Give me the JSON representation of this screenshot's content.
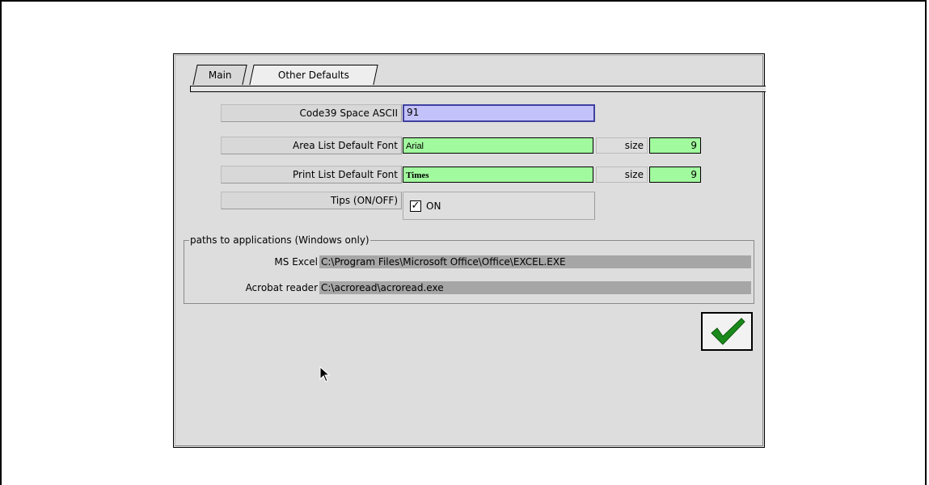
{
  "tabs": [
    {
      "label": "Main"
    },
    {
      "label": "Other Defaults"
    }
  ],
  "fields": {
    "code39": {
      "label": "Code39 Space ASCII",
      "value": "91"
    },
    "area_font": {
      "label": "Area List Default Font",
      "value": "Arial",
      "size_label": "size",
      "size": "9"
    },
    "print_font": {
      "label": "Print List Default Font",
      "value": "Times",
      "size_label": "size",
      "size": "9"
    },
    "tips": {
      "label": "Tips (ON/OFF)",
      "checkbox_label": "ON",
      "checked": true
    }
  },
  "paths": {
    "legend": "paths to applications (Windows only)",
    "excel": {
      "label": "MS Excel",
      "value": "C:\\Program Files\\Microsoft Office\\Office\\EXCEL.EXE"
    },
    "acrobat": {
      "label": "Acrobat reader",
      "value": "C:\\acroread\\acroread.exe"
    }
  },
  "ok_button": {
    "icon": "checkmark-icon",
    "color": "#1a8a1a"
  },
  "colors": {
    "field_green": "#a2fa9e",
    "field_blue": "#c4c2fb",
    "window_bg": "#dddddd",
    "path_field_gray": "#a6a6a6"
  }
}
